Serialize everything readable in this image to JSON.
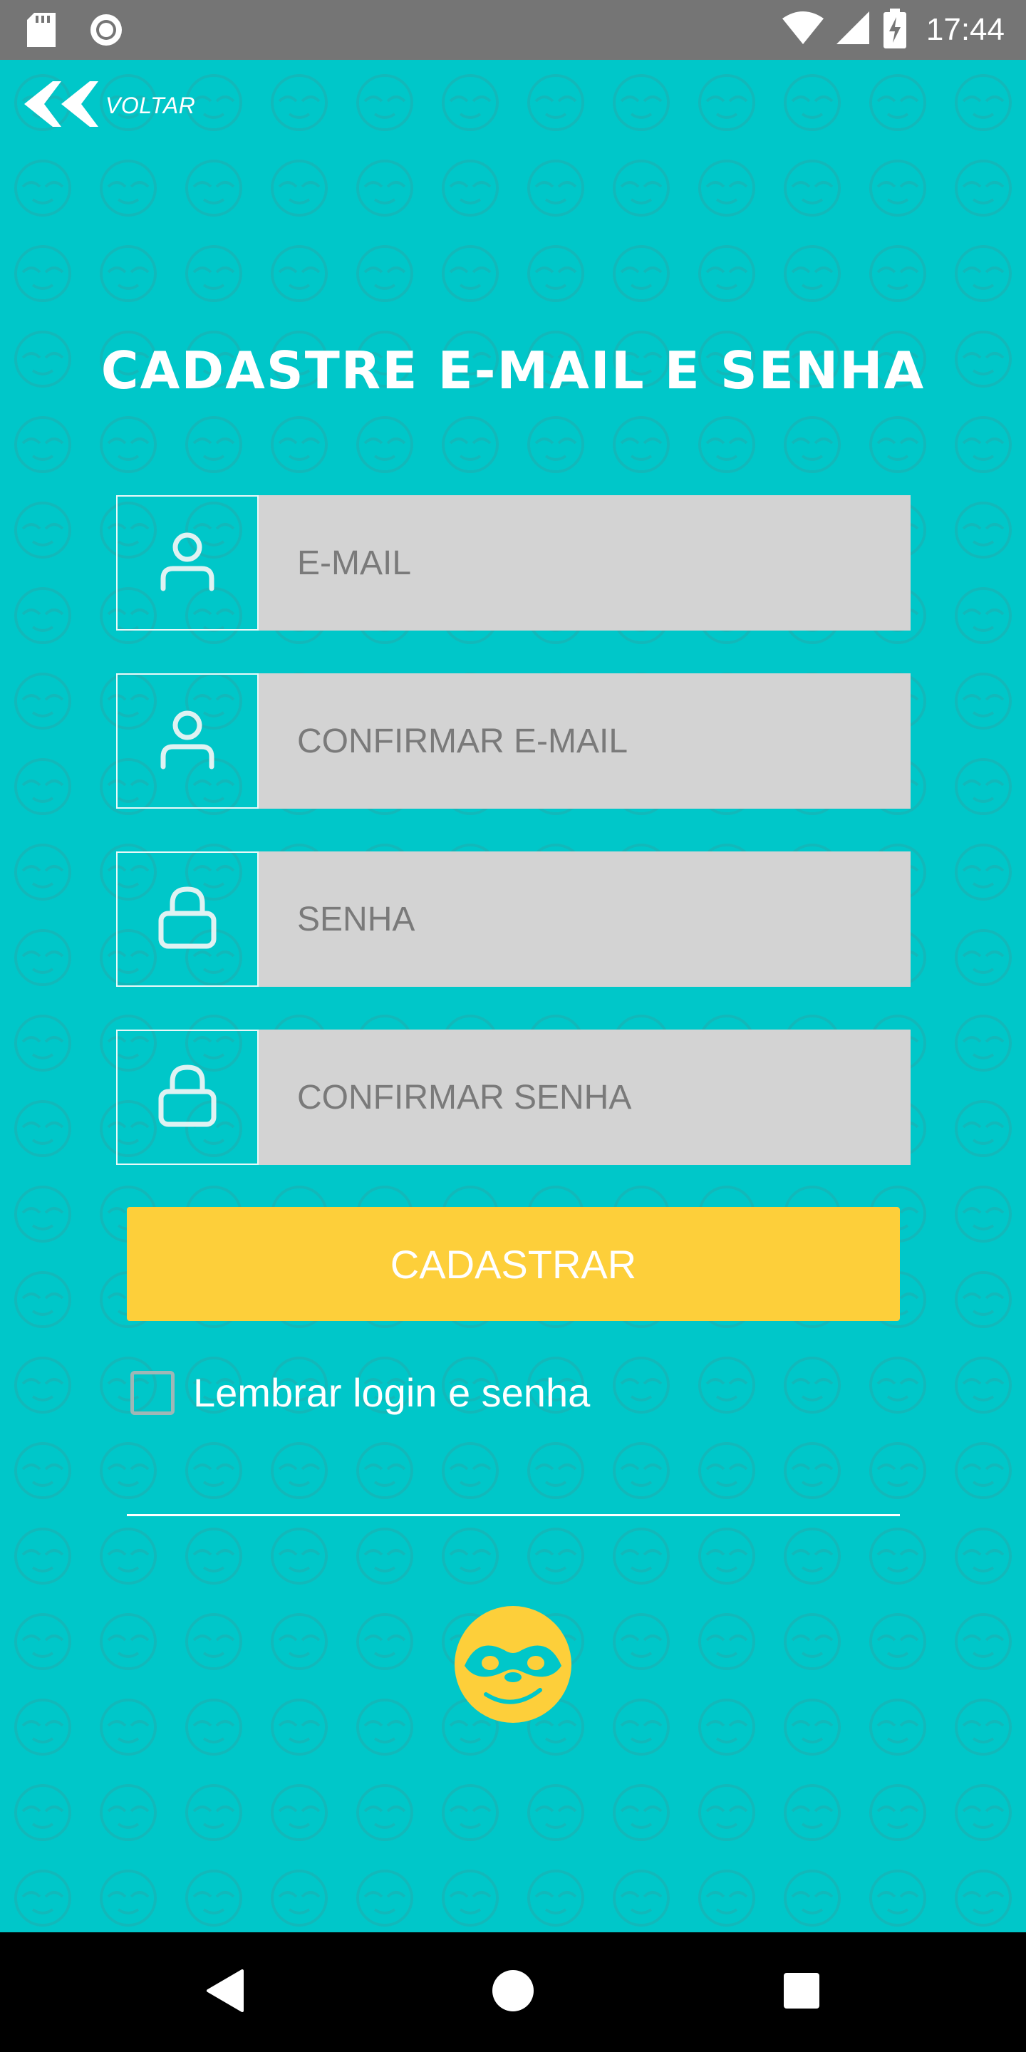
{
  "status_bar": {
    "time": "17:44",
    "left_icons": [
      "sd-card-icon",
      "circle-record-icon"
    ],
    "right_icons": [
      "wifi-icon",
      "signal-icon",
      "battery-charging-icon"
    ]
  },
  "header": {
    "back_label": "VOLTAR",
    "back_icon": "double-chevron-left-icon"
  },
  "page": {
    "title": "CADASTRE E-MAIL E SENHA"
  },
  "form": {
    "fields": [
      {
        "placeholder": "E-MAIL",
        "value": "",
        "icon": "user-icon"
      },
      {
        "placeholder": "CONFIRMAR E-MAIL",
        "value": "",
        "icon": "user-icon"
      },
      {
        "placeholder": "SENHA",
        "value": "",
        "icon": "lock-icon"
      },
      {
        "placeholder": "CONFIRMAR SENHA",
        "value": "",
        "icon": "lock-icon"
      }
    ],
    "submit_label": "CADASTRAR",
    "remember_label": "Lembrar login e senha",
    "remember_checked": false
  },
  "colors": {
    "background": "#00c7c9",
    "accent": "#fdcf3a",
    "input_bg": "#d3d3d3"
  },
  "logo": {
    "icon": "sloth-face-icon"
  },
  "nav_bar": {
    "icons": [
      "back-triangle-icon",
      "home-circle-icon",
      "recents-square-icon"
    ]
  }
}
